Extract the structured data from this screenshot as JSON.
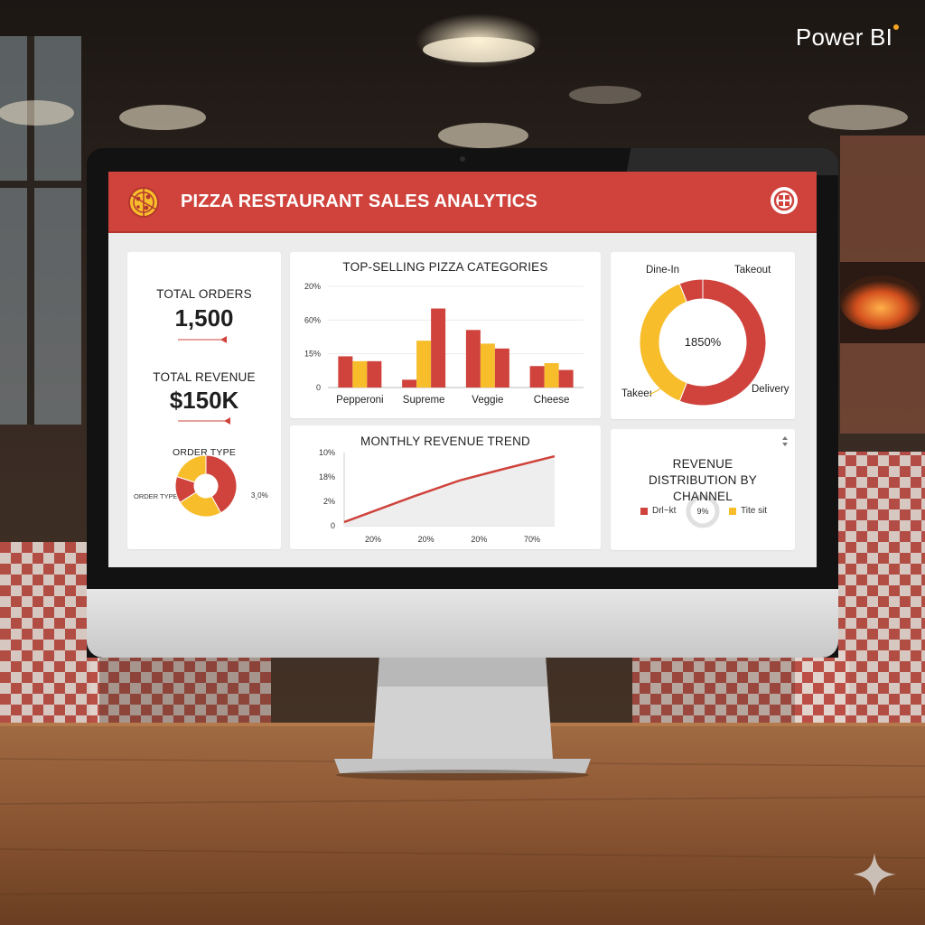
{
  "brand": {
    "name": "Power BI",
    "accent": "#f6a523"
  },
  "dashboard": {
    "title": "PIZZA RESTAURANT SALES ANALYTICS",
    "logo_icon": "pizza-icon",
    "header_icon": "grid-icon",
    "colors": {
      "red": "#cf433c",
      "yellow": "#f7bd2b",
      "header": "#cf433c"
    }
  },
  "kpis": {
    "orders_label": "TOTAL ORDERS",
    "orders_value": "1,500",
    "revenue_label": "TOTAL REVENUE",
    "revenue_value": "$150K"
  },
  "order_type": {
    "title": "ORDER TYPE",
    "left_label": "ORDER TYPE",
    "right_label": "3¸0%"
  },
  "chart_data": [
    {
      "type": "bar",
      "title": "TOP-SELLING PIZZA CATEGORIES",
      "categories": [
        "Pepperoni",
        "Supreme",
        "Veggie",
        "Cheese"
      ],
      "y_ticks": [
        "20%",
        "60%",
        "15%",
        "0"
      ],
      "series": [
        {
          "values": [
            0.32,
            0.08,
            0.59,
            0.22
          ]
        },
        {
          "values": [
            0.27,
            0.48,
            0.45,
            0.25
          ]
        },
        {
          "values": [
            0.27,
            0.81,
            0.4,
            0.18
          ]
        }
      ]
    },
    {
      "type": "line",
      "title": "MONTHLY REVENUE TREND",
      "y_ticks": [
        "10%",
        "18%",
        "2%",
        "0"
      ],
      "x_ticks": [
        "20%",
        "20%",
        "20%",
        "70%"
      ],
      "x": [
        0,
        0.33,
        0.55,
        0.75,
        1.0
      ],
      "y": [
        0.05,
        0.4,
        0.62,
        0.77,
        0.95
      ]
    },
    {
      "type": "pie",
      "title": "",
      "center_label": "1850%",
      "labels": [
        "Dine-In",
        "Takeout",
        "Delivery",
        "Takeeı"
      ],
      "slices": [
        {
          "label": "Takeout",
          "fraction": 0.56,
          "color": "#cf433c"
        },
        {
          "label": "Takeeı",
          "fraction": 0.38,
          "color": "#f7bd2b"
        },
        {
          "label": "Dine-In",
          "fraction": 0.06,
          "color": "#cf433c"
        }
      ]
    },
    {
      "type": "pie",
      "title": "REVENUE DISTRIBUTION BY CHANNEL",
      "center_label": "9%",
      "legend": [
        "Drl~kt",
        "Tite sit"
      ]
    }
  ],
  "order_type_donut": {
    "slices": [
      {
        "fraction": 0.42,
        "color": "#cf433c"
      },
      {
        "fraction": 0.24,
        "color": "#f7bd2b"
      },
      {
        "fraction": 0.14,
        "color": "#cf433c"
      },
      {
        "fraction": 0.2,
        "color": "#f7bd2b"
      }
    ]
  }
}
